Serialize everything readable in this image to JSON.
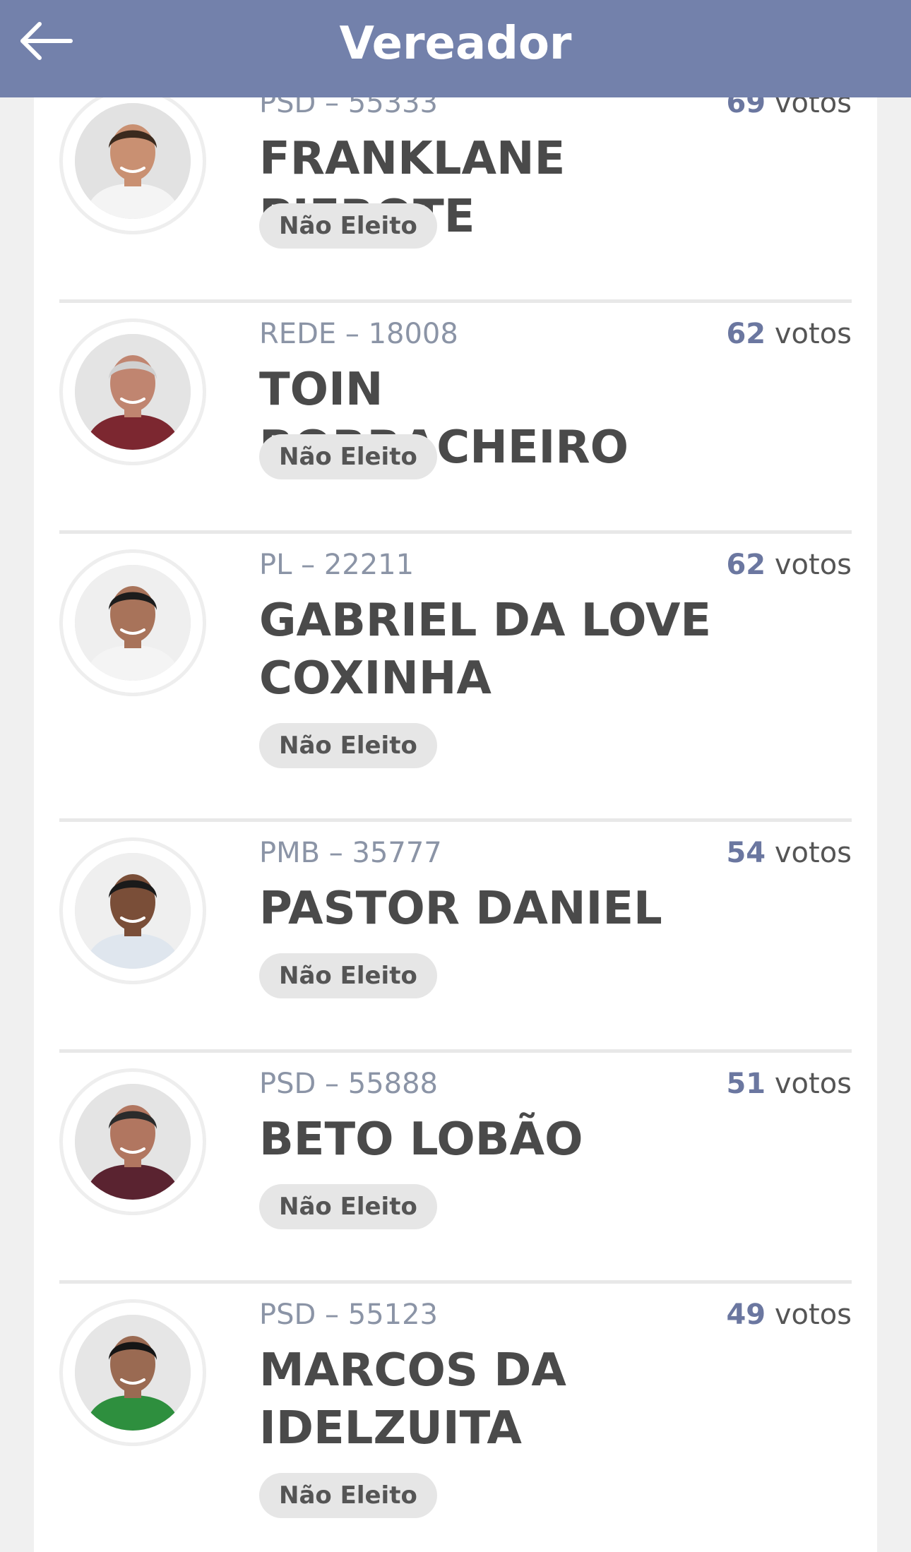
{
  "header": {
    "title": "Vereador",
    "back_icon": "arrow-left-icon",
    "background": "#7381ab"
  },
  "candidates": [
    {
      "party": "PSD – 55333",
      "name": "FRANKLANE PIEROTE",
      "votes": "69",
      "votes_unit": "votos",
      "status": "Não Eleito",
      "avatar_bg": "#e2e2e2",
      "hair": "#3b2a1e",
      "skin": "#c99072",
      "shirt": "#f4f4f4"
    },
    {
      "party": "REDE – 18008",
      "name": "TOIN BORRACHEIRO",
      "votes": "62",
      "votes_unit": "votos",
      "status": "Não Eleito",
      "avatar_bg": "#e4e4e4",
      "hair": "#d0d0d0",
      "skin": "#c08570",
      "shirt": "#7c2730"
    },
    {
      "party": "PL – 22211",
      "name": "GABRIEL DA LOVE COXINHA",
      "votes": "62",
      "votes_unit": "votos",
      "status": "Não Eleito",
      "avatar_bg": "#efefef",
      "hair": "#1c1c1c",
      "skin": "#a8735a",
      "shirt": "#f4f4f4"
    },
    {
      "party": "PMB – 35777",
      "name": "PASTOR DANIEL",
      "votes": "54",
      "votes_unit": "votos",
      "status": "Não Eleito",
      "avatar_bg": "#efefef",
      "hair": "#1a1a1a",
      "skin": "#7a4e38",
      "shirt": "#dfe6ee"
    },
    {
      "party": "PSD – 55888",
      "name": "BETO LOBÃO",
      "votes": "51",
      "votes_unit": "votos",
      "status": "Não Eleito",
      "avatar_bg": "#e4e4e4",
      "hair": "#2b2b2b",
      "skin": "#b17660",
      "shirt": "#5a2330"
    },
    {
      "party": "PSD – 55123",
      "name": "MARCOS DA IDELZUITA",
      "votes": "49",
      "votes_unit": "votos",
      "status": "Não Eleito",
      "avatar_bg": "#e6e6e6",
      "hair": "#151515",
      "skin": "#9a6a52",
      "shirt": "#2e8f3e"
    }
  ]
}
